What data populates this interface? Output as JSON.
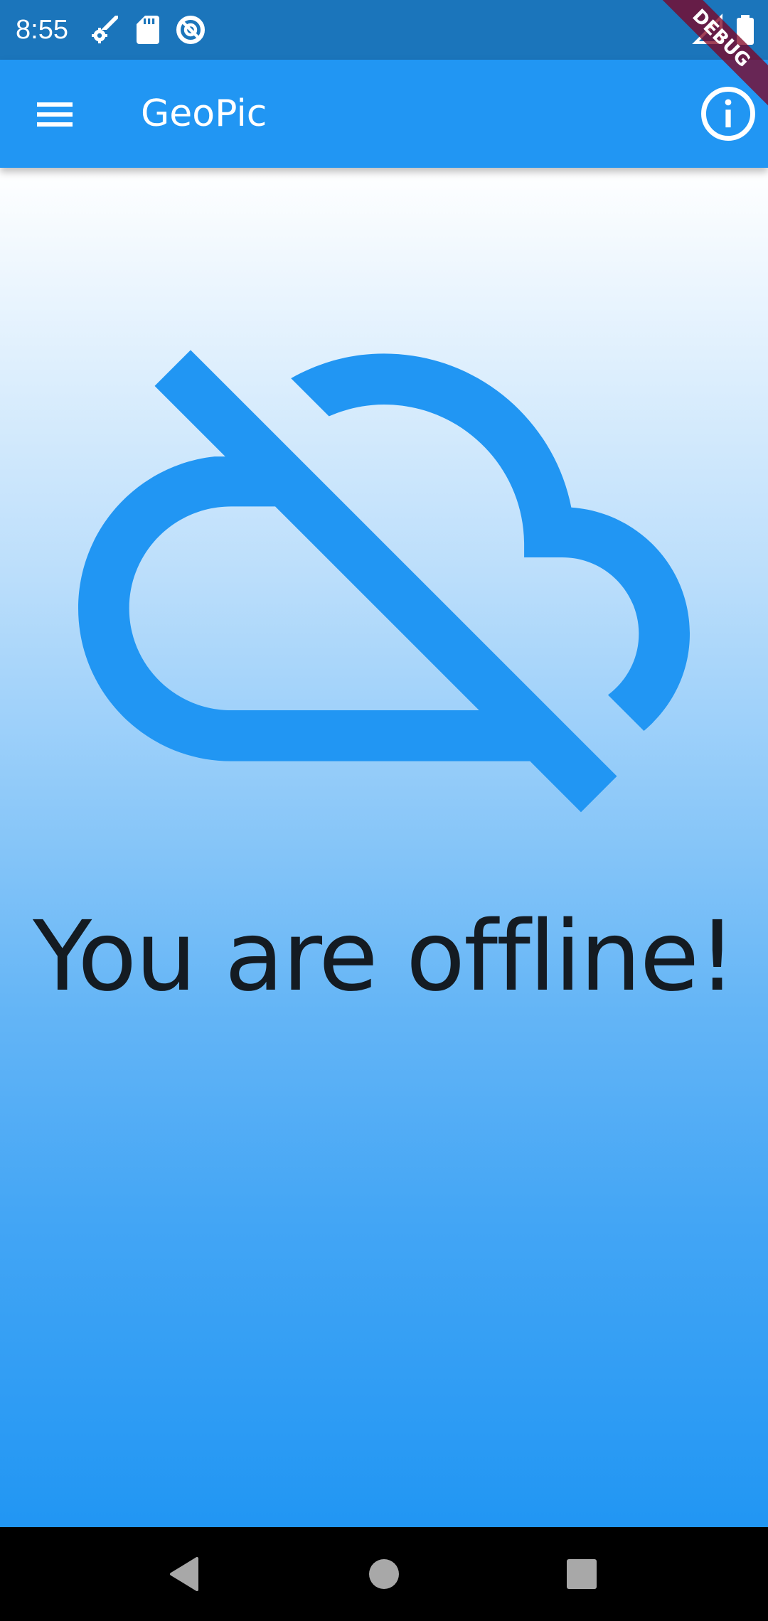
{
  "status_bar": {
    "time": "8:55",
    "icons": [
      "settings-sync-icon",
      "sd-card-icon",
      "data-saver-icon",
      "signal-icon",
      "battery-icon"
    ]
  },
  "debug_banner": "DEBUG",
  "app_bar": {
    "title": "GeoPic",
    "menu_icon": "menu-icon",
    "info_icon": "info-icon"
  },
  "body": {
    "illustration_icon": "cloud-off-icon",
    "message": "You are offline!"
  },
  "navigation_bar": {
    "icons": [
      "back-icon",
      "home-icon",
      "recents-icon"
    ]
  },
  "colors": {
    "status_bar": "#1B75BB",
    "app_bar": "#2196F3",
    "accent": "#2196F3",
    "message_text": "#141B22"
  }
}
